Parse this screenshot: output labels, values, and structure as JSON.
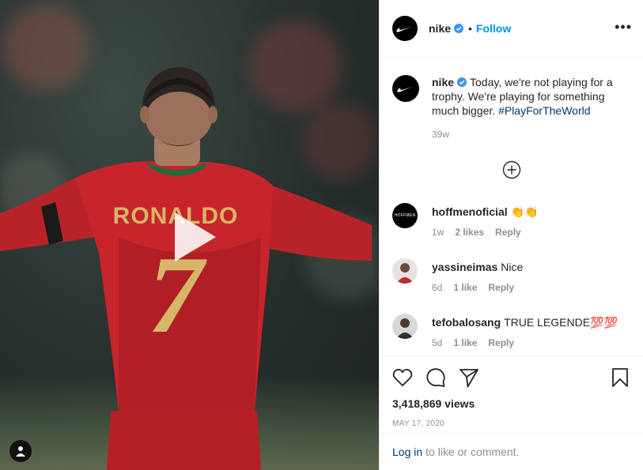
{
  "post": {
    "username": "nike",
    "follow_label": "Follow",
    "dot": "•",
    "more": "•••",
    "jersey_name": "RONALDO",
    "jersey_number": "7"
  },
  "caption": {
    "username": "nike",
    "text": "Today, we're not playing for a trophy. We're playing for something much bigger.",
    "hashtag": "#PlayForTheWorld",
    "time": "39w"
  },
  "comments": [
    {
      "username": "hoffmenoficial",
      "text": "👏👏",
      "avatar_label": "HOFFMEN",
      "time": "1w",
      "likes": "2 likes",
      "reply": "Reply"
    },
    {
      "username": "yassineimas",
      "text": "Nice",
      "time": "6d",
      "likes": "1 like",
      "reply": "Reply"
    },
    {
      "username": "tefobalosang",
      "text": "TRUE LEGENDE💯💯",
      "time": "5d",
      "likes": "1 like",
      "reply": "Reply"
    }
  ],
  "stats": {
    "views": "3,418,869 views",
    "date": "MAY 17, 2020"
  },
  "login": {
    "link": "Log in",
    "rest": "to like or comment."
  },
  "colors": {
    "accent": "#0095f6",
    "hashtag": "#00376b",
    "muted": "#8e8e8e",
    "jersey_red": "#c8242b",
    "jersey_gold": "#d9b56a"
  },
  "icons": {
    "play": "play-icon",
    "verified": "verified-badge-icon",
    "more": "more-options-icon",
    "load_more": "plus-circle-icon",
    "like": "heart-icon",
    "comment": "comment-bubble-icon",
    "share": "paper-plane-icon",
    "save": "bookmark-icon",
    "user_tag": "user-tag-icon"
  }
}
